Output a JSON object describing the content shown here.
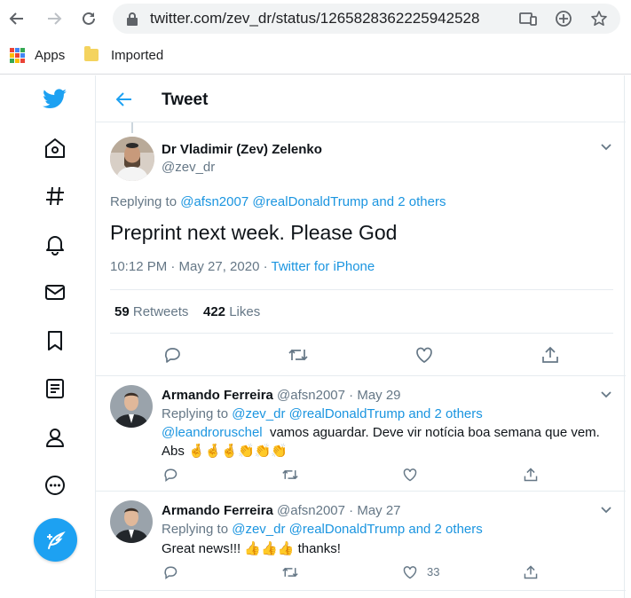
{
  "browser": {
    "url": "twitter.com/zev_dr/status/1265828362225942528",
    "bookmarks": [
      {
        "label": "Apps",
        "icon": "apps-grid-icon"
      },
      {
        "label": "Imported",
        "icon": "folder-icon"
      }
    ],
    "colors": {
      "toolbar_bg": "#f1f3f4",
      "folder": "#f4d35e"
    }
  },
  "nav": {
    "icons": [
      "twitter-logo-icon",
      "home-icon",
      "explore-hashtag-icon",
      "notifications-bell-icon",
      "messages-envelope-icon",
      "bookmarks-icon",
      "lists-icon",
      "profile-icon",
      "more-icon",
      "compose-tweet-icon"
    ]
  },
  "header": {
    "title": "Tweet"
  },
  "main_tweet": {
    "author_name": "Dr Vladimir (Zev) Zelenko",
    "handle": "@zev_dr",
    "replying_prefix": "Replying to",
    "replying_to": "@afsn2007 @realDonaldTrump and 2 others",
    "text": "Preprint next week.  Please God",
    "time": "10:12 PM · May 27, 2020 · ",
    "source": "Twitter for iPhone",
    "retweets_count": "59",
    "retweets_label": "Retweets",
    "likes_count": "422",
    "likes_label": "Likes"
  },
  "replies": [
    {
      "author_name": "Armando Ferreira",
      "meta": "@afsn2007 · May 29",
      "replying_prefix": "Replying to",
      "replying_to": "@zev_dr @realDonaldTrump and 2 others",
      "mention": "@leandroruschel",
      "text": "vamos aguardar. Deve vir notícia boa semana que vem.",
      "text2": "Abs",
      "emoji": "🤞🤞🤞👏👏👏",
      "like_count": ""
    },
    {
      "author_name": "Armando Ferreira",
      "meta": "@afsn2007 · May 27",
      "replying_prefix": "Replying to",
      "replying_to": "@zev_dr @realDonaldTrump and 2 others",
      "text": "Great news!!!",
      "emoji": "👍👍👍",
      "text_after": "thanks!",
      "like_count": "33"
    }
  ],
  "colors": {
    "twitter_blue": "#1da1f2",
    "link_blue": "#1b95e0",
    "muted": "#657786",
    "border": "#e6ecf0"
  }
}
